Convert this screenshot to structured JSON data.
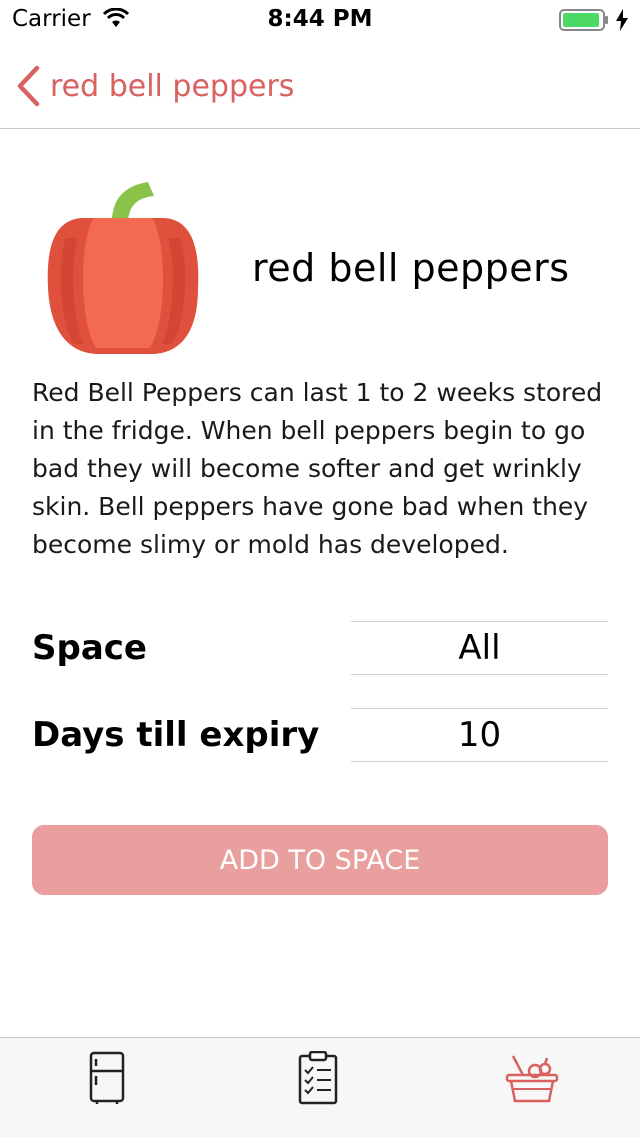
{
  "status_bar": {
    "carrier": "Carrier",
    "time": "8:44 PM"
  },
  "nav": {
    "back_label": "red bell peppers",
    "accent_color": "#d9615f"
  },
  "item": {
    "image_icon": "red-bell-pepper",
    "title": "red bell peppers",
    "description": "Red Bell Peppers can last 1 to 2 weeks stored in the fridge.  When bell peppers begin to go bad they will become softer and get wrinkly skin. Bell peppers have gone bad when they become slimy or mold has developed."
  },
  "form": {
    "space_label": "Space",
    "space_value": "All",
    "expiry_label": "Days till expiry",
    "expiry_value": "10"
  },
  "add_button": {
    "label": "ADD TO SPACE",
    "color": "#e89f9e"
  },
  "tabs": [
    {
      "icon": "fridge-icon",
      "active": false
    },
    {
      "icon": "checklist-icon",
      "active": false
    },
    {
      "icon": "basket-icon",
      "active": true
    }
  ]
}
